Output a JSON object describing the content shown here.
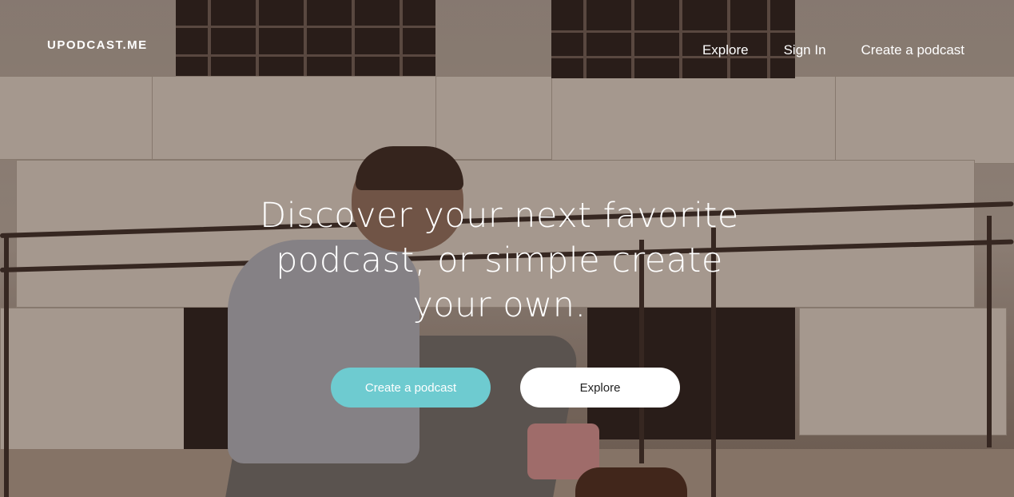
{
  "brand": {
    "logo": "UPODCAST.ME"
  },
  "nav": {
    "items": [
      {
        "label": "Explore"
      },
      {
        "label": "Sign In"
      },
      {
        "label": "Create a podcast"
      }
    ]
  },
  "hero": {
    "headline": "Discover your next favorite podcast, or simple create your own.",
    "primary_button": "Create a podcast",
    "secondary_button": "Explore"
  },
  "colors": {
    "accent": "#6ecbd0",
    "text_light": "#ffffff",
    "secondary_button_bg": "#ffffff"
  }
}
